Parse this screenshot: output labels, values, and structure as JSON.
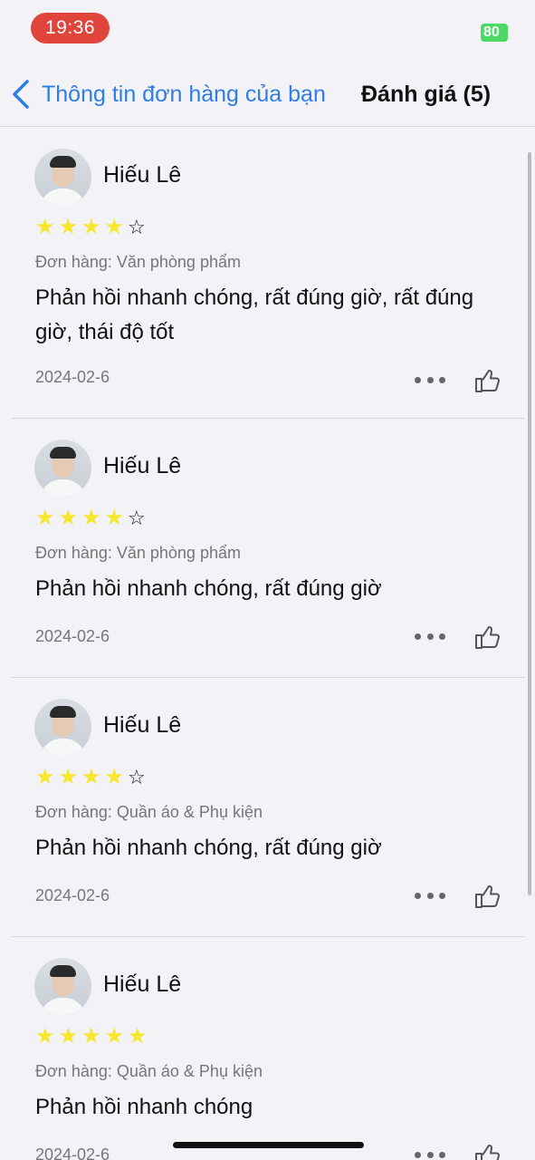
{
  "status_bar": {
    "time": "19:36",
    "battery": "80"
  },
  "nav": {
    "back_label": "Thông tin đơn hàng của bạn",
    "title": "Đánh giá (5)"
  },
  "reviews": [
    {
      "user": "Hiếu Lê",
      "rating": 4,
      "order": "Đơn hàng: Văn phòng phẩm",
      "comment": "Phản hồi nhanh chóng, rất đúng giờ, rất đúng giờ, thái độ tốt",
      "date": "2024-02-6"
    },
    {
      "user": "Hiếu Lê",
      "rating": 4,
      "order": "Đơn hàng: Văn phòng phẩm",
      "comment": "Phản hồi nhanh chóng, rất đúng giờ",
      "date": "2024-02-6"
    },
    {
      "user": "Hiếu Lê",
      "rating": 4,
      "order": "Đơn hàng: Quần áo & Phụ kiện",
      "comment": "Phản hồi nhanh chóng, rất đúng giờ",
      "date": "2024-02-6"
    },
    {
      "user": "Hiếu Lê",
      "rating": 5,
      "order": "Đơn hàng: Quần áo & Phụ kiện",
      "comment": "Phản hồi nhanh chóng",
      "date": "2024-02-6"
    }
  ],
  "icons": {
    "back": "chevron-left-icon",
    "more": "ellipsis-icon",
    "like": "thumbs-up-icon",
    "star": "star-icon"
  },
  "colors": {
    "accent": "#2f7ee6",
    "star_filled": "#f7e72c",
    "time_pill": "#e0443b",
    "battery": "#4cd964"
  }
}
